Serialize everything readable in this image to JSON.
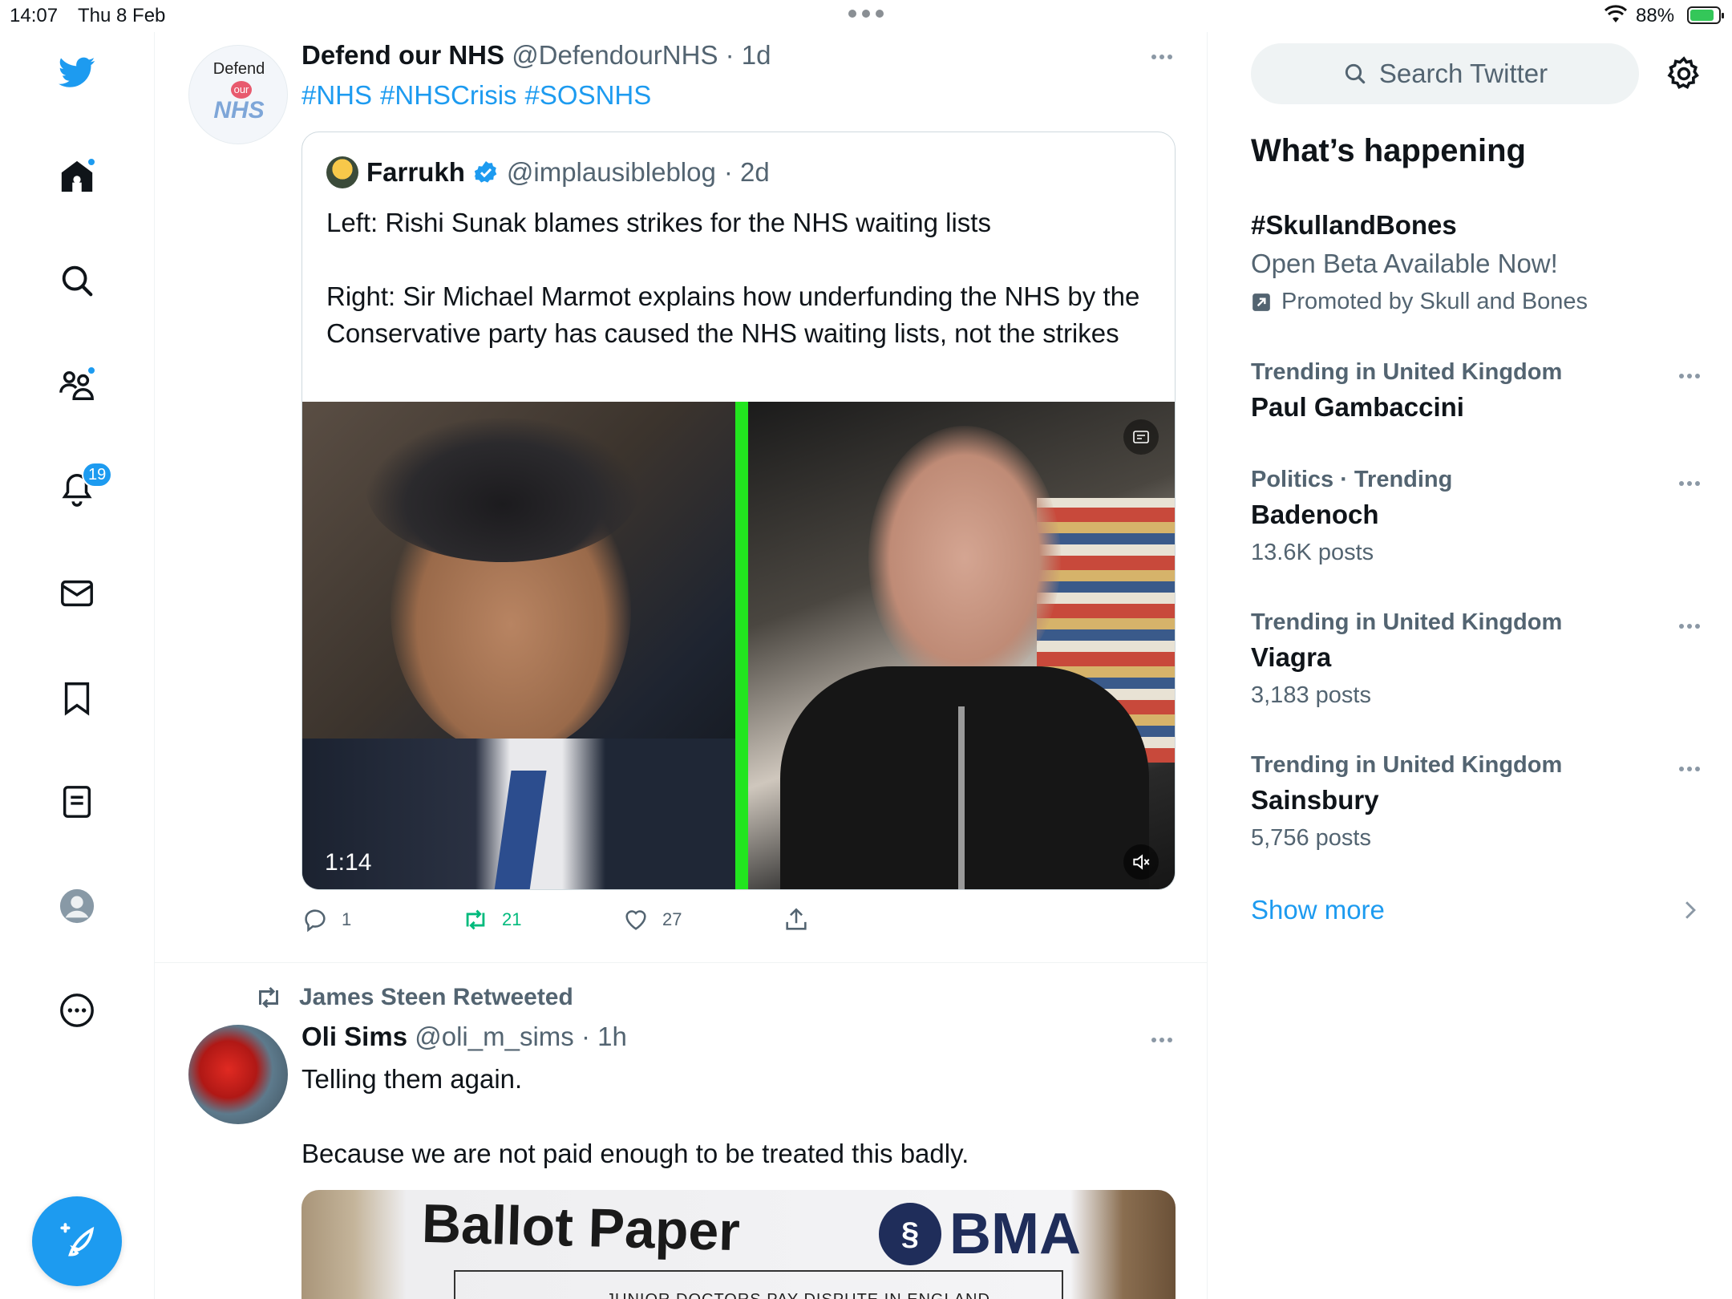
{
  "status_bar": {
    "time": "14:07",
    "date": "Thu 8 Feb",
    "battery": "88%"
  },
  "nav": {
    "notifications_count": "19"
  },
  "tweet1": {
    "name": "Defend our NHS",
    "handle": "@DefendourNHS",
    "time": "· 1d",
    "avatar_text": {
      "line1": "Defend",
      "line2": "our",
      "line3": "NHS"
    },
    "hashtags": [
      "#NHS",
      "#NHSCrisis",
      "#SOSNHS"
    ],
    "quote": {
      "name": "Farrukh",
      "handle": "@implausibleblog",
      "time": "· 2d",
      "text_1": "Left: Rishi Sunak blames strikes for the NHS waiting lists",
      "text_2": "Right: Sir Michael Marmot explains how underfunding the NHS by the Conservative party has caused the NHS waiting lists, not the strikes",
      "video_duration": "1:14"
    },
    "actions": {
      "replies": "1",
      "retweets": "21",
      "likes": "27"
    }
  },
  "tweet2": {
    "retweeted_by": "James Steen Retweeted",
    "name": "Oli Sims",
    "handle": "@oli_m_sims",
    "time": "· 1h",
    "text_1": "Telling them again.",
    "text_2": "Because we are not paid enough to be treated this badly.",
    "image": {
      "title": "Ballot Paper",
      "org": "BMA",
      "subtitle": "JUNIOR DOCTORS PAY DISPUTE IN ENGLAND"
    }
  },
  "sidebar": {
    "search_placeholder": "Search Twitter",
    "heading": "What’s happening",
    "promoted": {
      "title": "#SkullandBones",
      "description": "Open Beta Available Now!",
      "promoted_by": "Promoted by Skull and Bones"
    },
    "trends": [
      {
        "category": "Trending in United Kingdom",
        "title": "Paul Gambaccini",
        "posts": ""
      },
      {
        "category": "Politics · Trending",
        "title": "Badenoch",
        "posts": "13.6K posts"
      },
      {
        "category": "Trending in United Kingdom",
        "title": "Viagra",
        "posts": "3,183 posts"
      },
      {
        "category": "Trending in United Kingdom",
        "title": "Sainsbury",
        "posts": "5,756 posts"
      }
    ],
    "show_more": "Show more"
  },
  "colors": {
    "accent": "#1d9bf0",
    "retweet": "#00ba7c",
    "muted": "#536471"
  }
}
